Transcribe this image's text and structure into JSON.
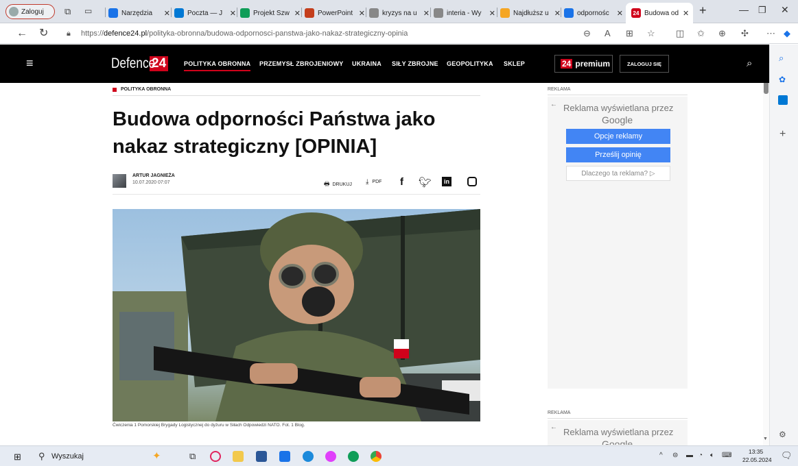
{
  "browser": {
    "profile_label": "Zaloguj",
    "tabs": [
      {
        "label": "Narzędzia",
        "color": "#1a73e8"
      },
      {
        "label": "Poczta — J",
        "color": "#0078d4"
      },
      {
        "label": "Projekt Szw",
        "color": "#0f9d58"
      },
      {
        "label": "PowerPoint",
        "color": "#c43e1c"
      },
      {
        "label": "kryzys na u",
        "color": "#888"
      },
      {
        "label": "interia - Wy",
        "color": "#888"
      },
      {
        "label": "Najdłuższ u",
        "color": "#f5a623"
      },
      {
        "label": "odpornośc",
        "color": "#1a73e8"
      }
    ],
    "active_tab": {
      "label": "Budowa od",
      "icon_text": "24",
      "color": "#d0021b"
    },
    "new_tab": "+",
    "url_prefix": "https://",
    "url_domain": "defence24.pl",
    "url_path": "/polityka-obronna/budowa-odpornosci-panstwa-jako-nakaz-strategiczny-opinia"
  },
  "site": {
    "logo_text": "Defence",
    "logo_num": "24",
    "nav": [
      "POLITYKA OBRONNA",
      "PRZEMYSŁ ZBROJENIOWY",
      "UKRAINA",
      "SIŁY ZBROJNE",
      "GEOPOLITYKA",
      "SKLEP"
    ],
    "premium_num": "24",
    "premium_label": "premium",
    "login_label": "ZALOGUJ SIĘ"
  },
  "article": {
    "category": "POLITYKA OBRONNA",
    "title_line1": "Budowa odporności Państwa jako",
    "title_line2": "nakaz strategiczny [OPINIA]",
    "author": "ARTUR JAGNIEŻA",
    "date": "10.07.2020 07:07",
    "print_label": "DRUKUJ",
    "pdf_label": "PDF",
    "caption": "Ćwiczenia 1 Pomorskiej Brygady Logistycznej do dyżuru w Siłach Odpowiedzi NATO. Fot. 1 Blog."
  },
  "ads": {
    "label_top": "REKLAMA",
    "shown_by": "Reklama wyświetlana przez",
    "google": "Google",
    "options_btn": "Opcje reklamy",
    "feedback_btn": "Prześlij opinię",
    "why_btn": "Dlaczego ta reklama? ▷",
    "label_bottom": "REKLAMA",
    "shown_by_2": "Reklama wyświetlana przez",
    "google_2": "Google"
  },
  "taskbar": {
    "search_label": "Wyszukaj",
    "time": "13:35",
    "date": "22.05.2024"
  },
  "colors": {
    "brand_red": "#d0021b",
    "google_blue": "#4285f4"
  }
}
